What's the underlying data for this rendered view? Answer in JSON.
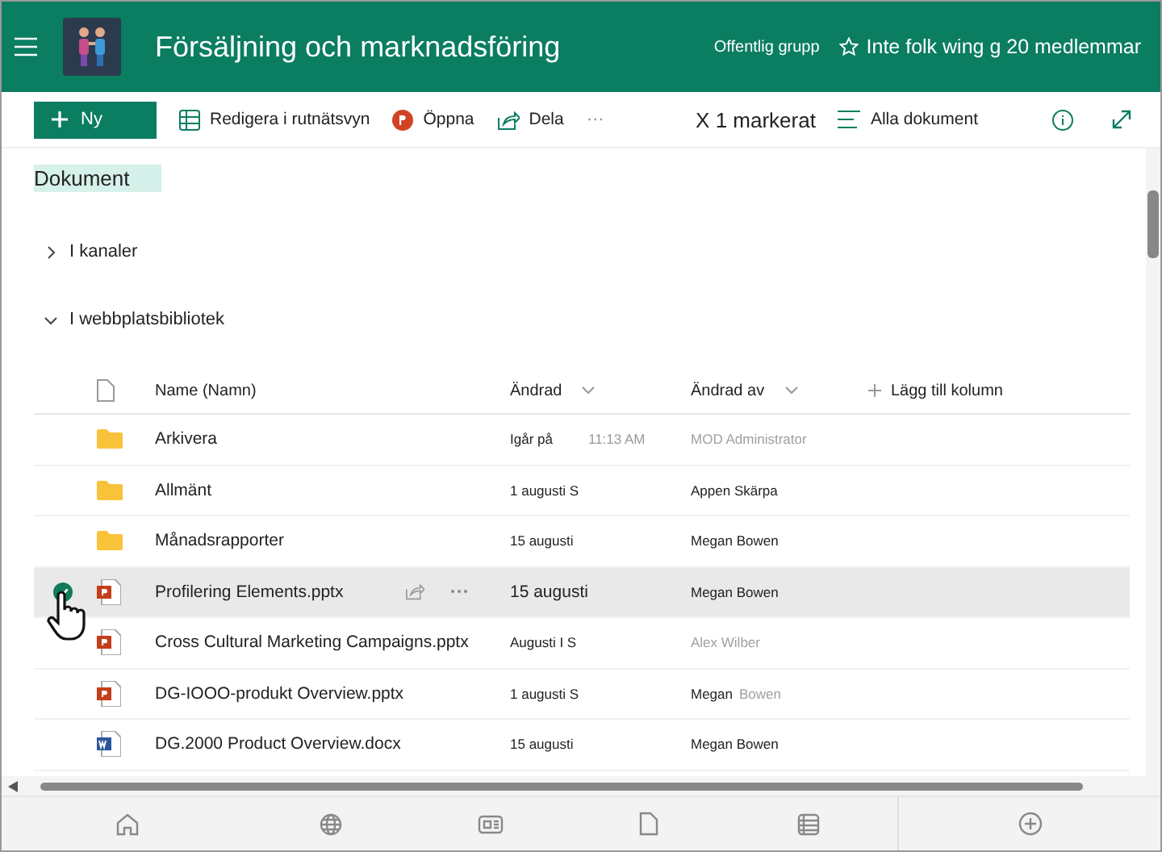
{
  "header": {
    "title": "Försäljning och marknadsföring",
    "privacy": "Offentlig grupp",
    "followers": "Inte folk wing g 20 medlemmar"
  },
  "toolbar": {
    "new": "Ny",
    "actions": [
      {
        "kind": "grid",
        "label": "Redigera i rutnätsvyn"
      },
      {
        "kind": "ppt",
        "label": "Öppna"
      },
      {
        "kind": "share",
        "label": "Dela"
      },
      {
        "kind": "more",
        "label": "···"
      }
    ],
    "selection": "X 1 markerat",
    "view": "Alla dokument"
  },
  "page_title": "Dokument",
  "sections": [
    {
      "label": "I kanaler",
      "expanded": false
    },
    {
      "label": "I webbplatsbibliotek",
      "expanded": true
    }
  ],
  "table": {
    "columns": [
      "Name (Namn)",
      "Ändrad",
      "Ändrad av"
    ],
    "add_column": "Lägg till kolumn",
    "rows": [
      {
        "kind": "folder",
        "name": "Arkivera",
        "modified": "Igår på",
        "time": "11:13 AM",
        "modified_by": [
          {
            "text": "MOD Administrator",
            "dimmed": true
          }
        ],
        "selected": false
      },
      {
        "kind": "folder",
        "name": "Allmänt",
        "modified": "1 augusti S",
        "modified_by": [
          {
            "text": "Appen Skärpa",
            "dimmed": false
          }
        ],
        "selected": false
      },
      {
        "kind": "folder",
        "name": "Månadsrapporter",
        "modified": "15 augusti",
        "modified_by": [
          {
            "text": "Megan Bowen",
            "dimmed": false
          }
        ],
        "selected": false
      },
      {
        "kind": "pptx",
        "name": "Profilering Elements.pptx",
        "modified": "15 augusti",
        "modified_by": [
          {
            "text": "Megan Bowen",
            "dimmed": false
          }
        ],
        "selected": true
      },
      {
        "kind": "pptx",
        "name": "Cross Cultural Marketing Campaigns.pptx",
        "modified": "Augusti I S",
        "modified_by": [
          {
            "text": "Alex Wilber",
            "dimmed": true
          }
        ],
        "selected": false
      },
      {
        "kind": "pptx",
        "name": "DG-IOOO-produkt Overview.pptx",
        "modified": "1 augusti S",
        "modified_by": [
          {
            "text": "Megan",
            "dimmed": false
          },
          {
            "text": "Bowen",
            "dimmed": true
          }
        ],
        "selected": false
      },
      {
        "kind": "docx",
        "name": "DG.2000 Product Overview.docx",
        "modified": "15 augusti",
        "modified_by": [
          {
            "text": "Megan Bowen",
            "dimmed": false
          }
        ],
        "selected": false
      }
    ]
  },
  "bottom_nav": [
    {
      "kind": "home"
    },
    {
      "kind": "globe"
    },
    {
      "kind": "news"
    },
    {
      "kind": "file"
    },
    {
      "kind": "list"
    },
    {
      "kind": "add"
    }
  ]
}
